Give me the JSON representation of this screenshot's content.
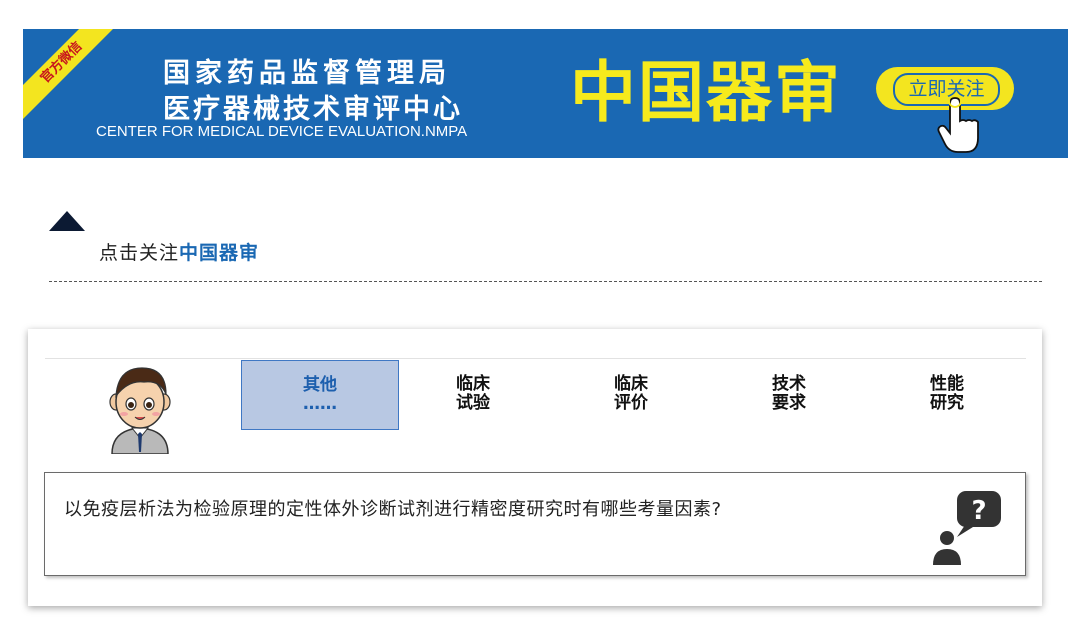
{
  "banner": {
    "ribbon": "官方微信",
    "org_line1": "国家药品监督管理局",
    "org_line2": "医疗器械技术审评中心",
    "org_en": "CENTER FOR MEDICAL DEVICE EVALUATION.NMPA",
    "big_title": "中国器审",
    "follow_button": "立即关注",
    "hand_icon": "pointing-hand-icon"
  },
  "click_follow": {
    "prefix": "点击关注",
    "brand": "中国器审"
  },
  "tabs": [
    {
      "line1": "其他",
      "line2": "……",
      "active": true
    },
    {
      "line1": "临床",
      "line2": "试验",
      "active": false
    },
    {
      "line1": "临床",
      "line2": "评价",
      "active": false
    },
    {
      "line1": "技术",
      "line2": "要求",
      "active": false
    },
    {
      "line1": "性能",
      "line2": "研究",
      "active": false
    }
  ],
  "question": {
    "text": "以免疫层析法为检验原理的定性体外诊断试剂进行精密度研究时有哪些考量因素?",
    "icon": "question-person-icon"
  },
  "colors": {
    "banner_blue": "#1a68b3",
    "banner_yellow": "#f3e51f",
    "active_tab": "#b8c8e3"
  }
}
